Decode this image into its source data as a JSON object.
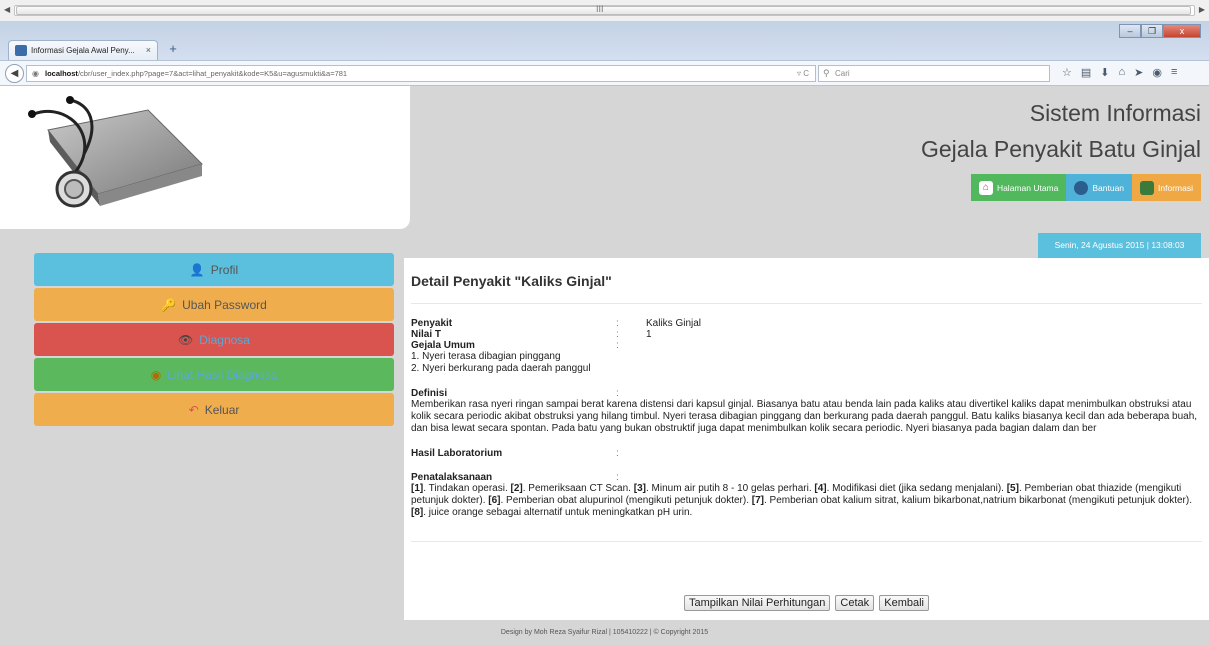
{
  "browser": {
    "tab_title": "Informasi Gejala Awal Peny...",
    "tab_close": "×",
    "new_tab": "+",
    "url_host": "localhost",
    "url_path": "/cbr/user_index.php?page=7&act=lihat_penyakit&kode=K5&u=agusmukti&a=781",
    "search_placeholder": "Cari",
    "window_buttons": [
      "–",
      "❐",
      "x"
    ],
    "scroll_grip": "III"
  },
  "header": {
    "title_line1": "Sistem Informasi",
    "title_line2": "Gejala Penyakit Batu Ginjal",
    "nav": [
      {
        "label": "Halaman Utama",
        "icon": "home-icon"
      },
      {
        "label": "Bantuan",
        "icon": "user-help-icon"
      },
      {
        "label": "Informasi",
        "icon": "info-icon"
      }
    ],
    "datetime": "Senin, 24 Agustus 2015   |   13:08:03"
  },
  "sidebar": {
    "items": [
      {
        "label": "Profil",
        "color": "#5bc0de"
      },
      {
        "label": "Ubah Password",
        "color": "#f0ad4e"
      },
      {
        "label": "Diagnosa",
        "color": "#d9534f"
      },
      {
        "label": "Lihat Hasil Diagnosa",
        "color": "#5cb85c"
      },
      {
        "label": "Keluar",
        "color": "#f0ad4e"
      }
    ]
  },
  "detail": {
    "heading": "Detail Penyakit \"Kaliks Ginjal\"",
    "penyakit_label": "Penyakit",
    "penyakit_value": "Kaliks Ginjal",
    "nilai_label": "Nilai T",
    "nilai_value": "1",
    "gejala_label": "Gejala Umum",
    "gejala": [
      "1. Nyeri terasa dibagian pinggang",
      "2. Nyeri berkurang pada daerah panggul"
    ],
    "definisi_label": "Definisi",
    "definisi": "Memberikan rasa nyeri ringan sampai berat karena distensi dari kapsul ginjal. Biasanya batu atau benda lain pada kaliks atau divertikel kaliks dapat menimbulkan obstruksi atau kolik secara periodic akibat obstruksi yang hilang timbul. Nyeri terasa dibagian pinggang dan berkurang pada daerah panggul. Batu kaliks biasanya kecil dan ada beberapa buah, dan bisa lewat secara spontan. Pada batu yang bukan obstruktif juga dapat menimbulkan kolik secara periodic. Nyeri biasanya pada bagian dalam dan ber",
    "lab_label": "Hasil Laboratorium",
    "penatalaksanaan_label": "Penatalaksanaan",
    "colon": ":",
    "steps": [
      {
        "n": "[1]",
        "t": ". Tindakan operasi. "
      },
      {
        "n": "[2]",
        "t": ". Pemeriksaan CT Scan. "
      },
      {
        "n": "[3]",
        "t": ". Minum air putih 8 - 10 gelas perhari. "
      },
      {
        "n": "[4]",
        "t": ". Modifikasi diet (jika sedang menjalani). "
      },
      {
        "n": "[5]",
        "t": ". Pemberian obat thiazide (mengikuti petunjuk dokter). "
      },
      {
        "n": "[6]",
        "t": ". Pemberian obat alupurinol (mengikuti petunjuk dokter). "
      },
      {
        "n": "[7]",
        "t": ". Pemberian obat kalium sitrat, kalium bikarbonat,natrium bikarbonat (mengikuti petunjuk dokter). "
      },
      {
        "n": "[8]",
        "t": ". juice orange sebagai alternatif untuk meningkatkan pH urin."
      }
    ]
  },
  "buttons": {
    "nilai": "Tampilkan Nilai Perhitungan",
    "cetak": "Cetak",
    "kembali": "Kembali"
  },
  "footer": "Design by Moh Reza Syaifur Rizal | 105410222 | © Copyright 2015"
}
